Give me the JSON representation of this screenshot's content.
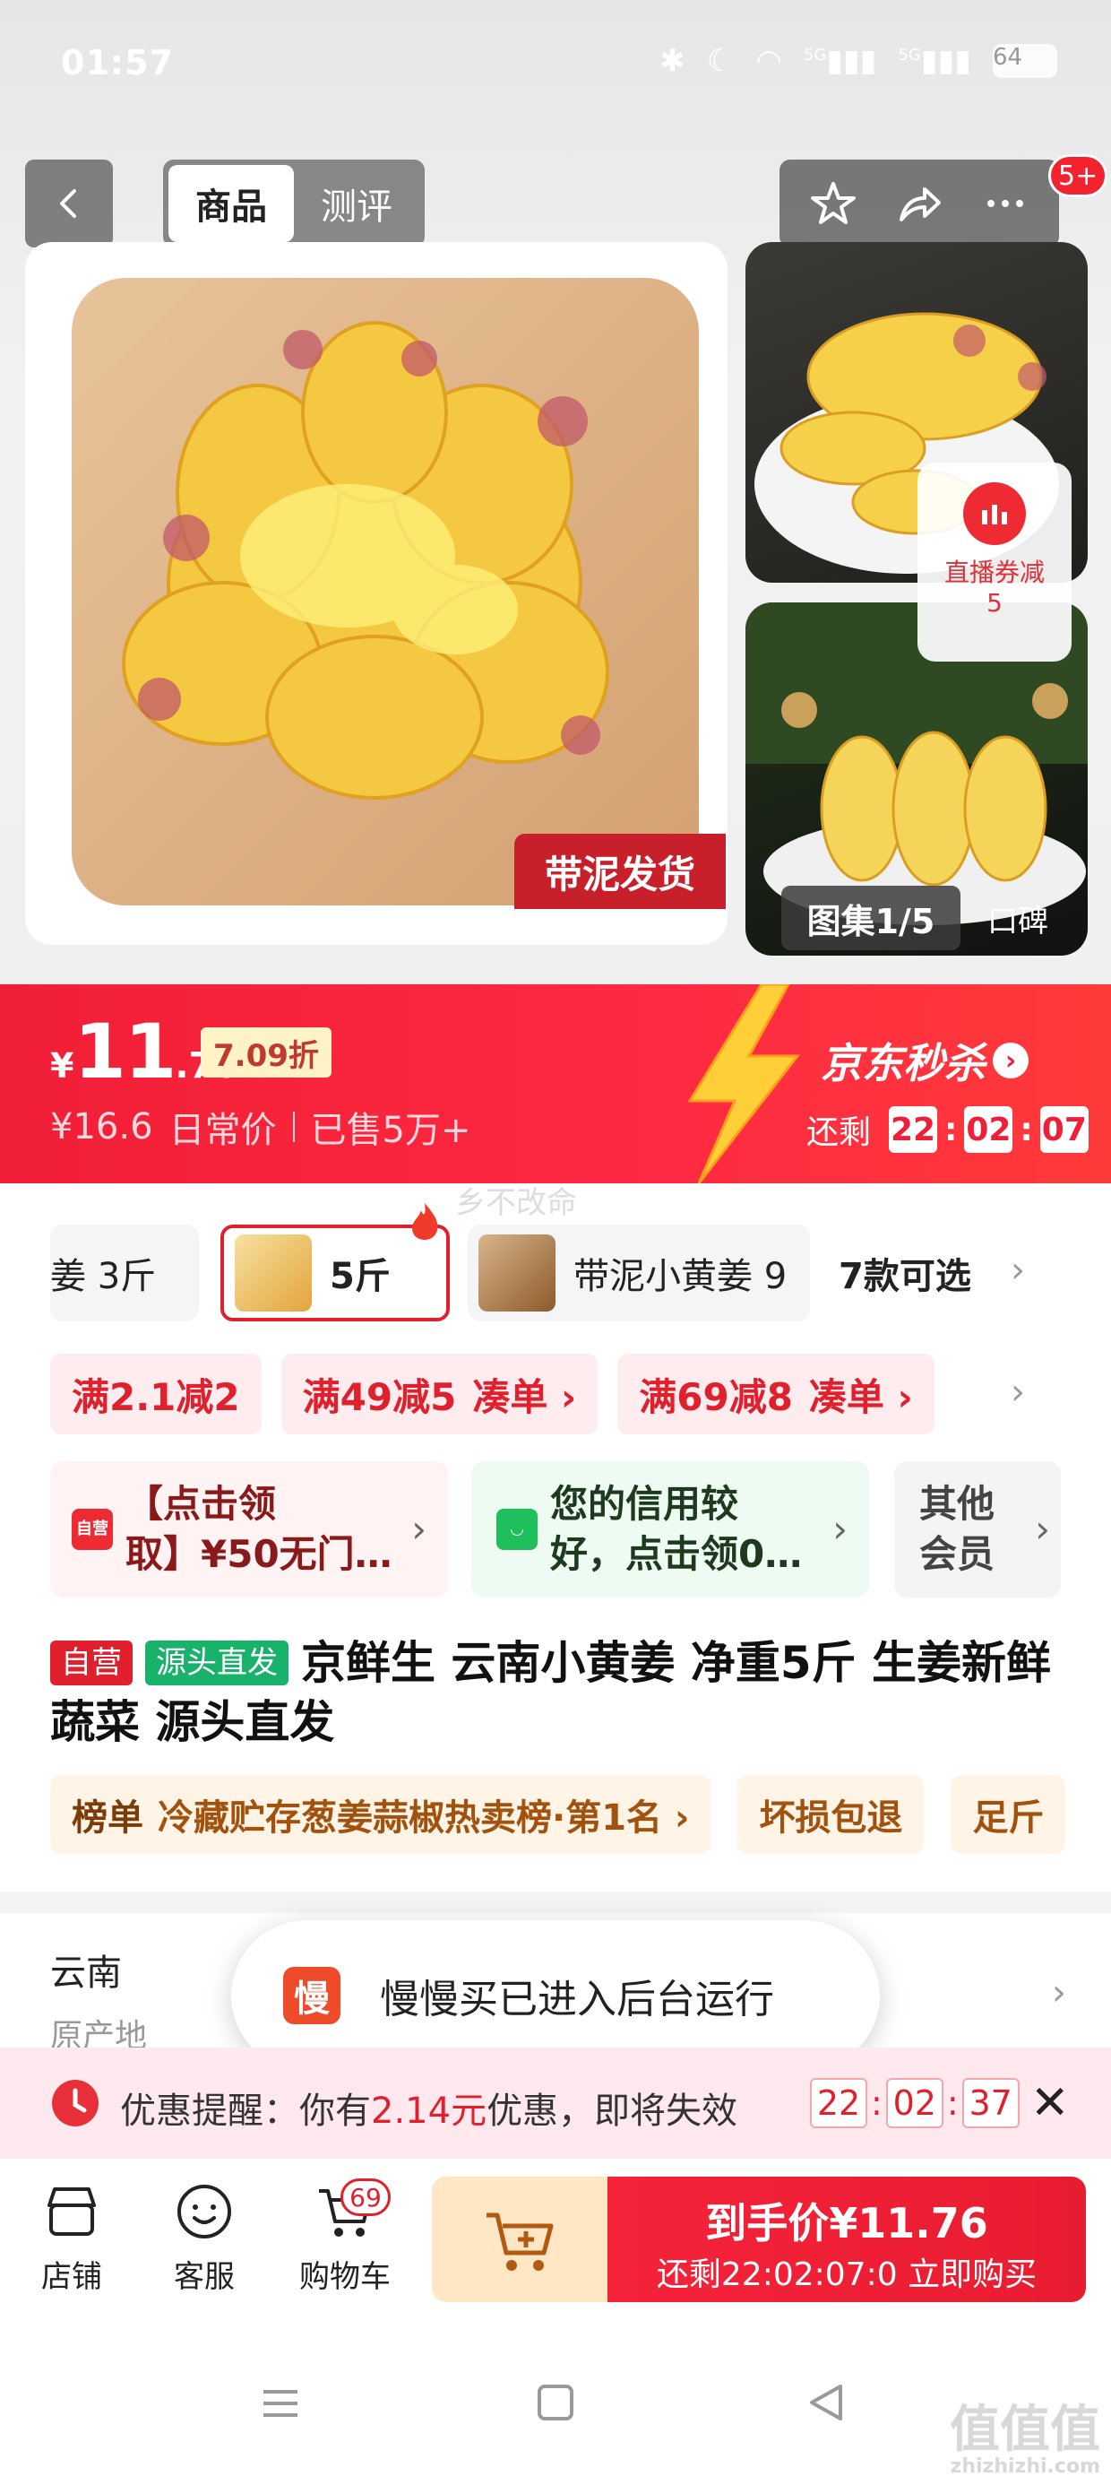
{
  "status_bar": {
    "time": "01:57",
    "battery": "64",
    "signal1": "5G",
    "signal2": "5G"
  },
  "header": {
    "tabs": [
      {
        "label": "商品",
        "active": true
      },
      {
        "label": "测评",
        "active": false
      }
    ],
    "message_badge": "5+",
    "icons": [
      "back-icon",
      "star-icon",
      "share-icon",
      "more-icon"
    ]
  },
  "gallery": {
    "mud_tag": "带泥发货",
    "live_coupon": "直播券减5",
    "count": "图集1/5",
    "review_label": "口碑"
  },
  "price_banner": {
    "currency": "¥",
    "price_int": "11",
    "price_dec": ".76",
    "discount": "7.09折",
    "original_price": "¥16.6",
    "daily_label": "日常价",
    "sold": "已售5万+",
    "seckill": "京东秒杀",
    "remaining_label": "还剩",
    "countdown": [
      "22",
      "02",
      "07"
    ]
  },
  "watermark": "乡不改命",
  "variants": {
    "items": [
      {
        "label": "姜 3斤"
      },
      {
        "label": "5斤",
        "selected": true
      },
      {
        "label": "带泥小黄姜 9"
      }
    ],
    "count_label": "7款可选"
  },
  "coupons": [
    {
      "label": "满2.1减2",
      "pile": ""
    },
    {
      "label": "满49减5",
      "pile": "凑单 ›"
    },
    {
      "label": "满69减8",
      "pile": "凑单 ›"
    }
  ],
  "benefits": [
    {
      "line1": "【点击领",
      "line2": "取】¥50无门…"
    },
    {
      "line1": "您的信用较",
      "line2": "好，点击领0…"
    },
    {
      "line1": "其他",
      "line2": "会员"
    }
  ],
  "product": {
    "tag_self": "自营",
    "tag_source": "源头直发",
    "title": "京鲜生 云南小黄姜 净重5斤 生姜新鲜蔬菜 源头直发"
  },
  "rank_tags": [
    {
      "label": "榜单",
      "text": "冷藏贮存葱姜蒜椒热卖榜·第1名 ›"
    },
    {
      "label": "",
      "text": "坏损包退"
    },
    {
      "label": "",
      "text": "足斤"
    }
  ],
  "origin": {
    "city": "云南",
    "label": "原产地"
  },
  "toast": {
    "icon_char": "慢",
    "text": "慢慢买已进入后台运行"
  },
  "reminder": {
    "prefix": "优惠提醒：你有",
    "amount": "2.14元",
    "suffix": "优惠，即将失效",
    "countdown": [
      "22",
      "02",
      "37"
    ]
  },
  "bottom_bar": {
    "store": "店铺",
    "service": "客服",
    "cart": "购物车",
    "cart_badge": "69",
    "buy_price_label": "到手价¥11.76",
    "buy_sub": "还剩22:02:07:0  立即购买"
  },
  "colors": {
    "jd_red": "#f01e36",
    "discount_bg": "#fff3c7",
    "green": "#18b26a"
  }
}
